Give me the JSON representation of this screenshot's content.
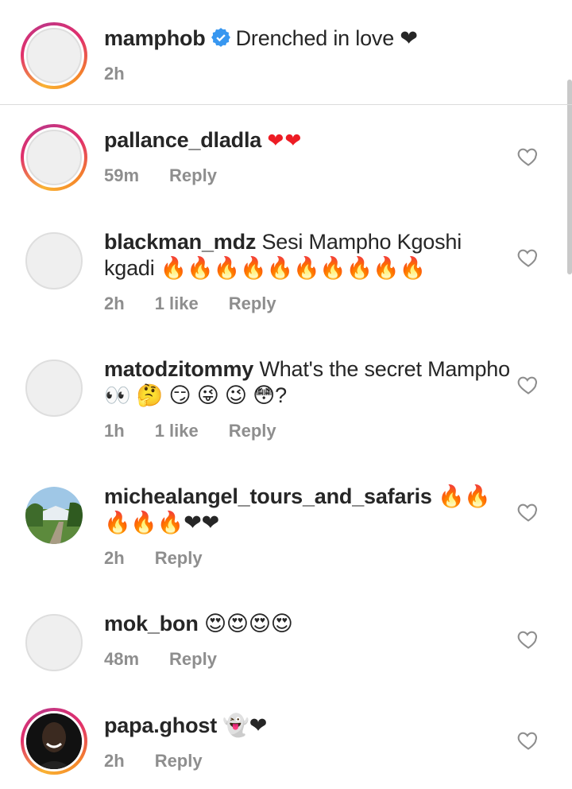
{
  "caption": {
    "username": "mamphob",
    "text": "Drenched in love ❤",
    "time": "2h"
  },
  "comments": [
    {
      "username": "pallance_dladla",
      "text": "❤❤",
      "time": "59m",
      "likes": "",
      "reply": "Reply"
    },
    {
      "username": "blackman_mdz",
      "text": "Sesi Mampho Kgoshi kgadi 🔥🔥🔥🔥🔥🔥🔥🔥🔥🔥",
      "time": "2h",
      "likes": "1 like",
      "reply": "Reply"
    },
    {
      "username": "matodzitommy",
      "text": "What's the secret Mampho 👀 🤔 😏 😜 😉 😳?",
      "time": "1h",
      "likes": "1 like",
      "reply": "Reply"
    },
    {
      "username": "micheal angel_tours_and_safaris",
      "text": "🔥🔥🔥🔥🔥❤❤",
      "time": "2h",
      "likes": "",
      "reply": "Reply"
    },
    {
      "username": "mok_bon",
      "text": "😍😍😍😍",
      "time": "48m",
      "likes": "",
      "reply": "Reply"
    },
    {
      "username": "papa.ghost",
      "text": "👻❤",
      "time": "2h",
      "likes": "",
      "reply": "Reply"
    }
  ],
  "colors": {
    "accent": "#3897f0",
    "heart": "#ed1c24",
    "muted": "#8e8e8e"
  }
}
